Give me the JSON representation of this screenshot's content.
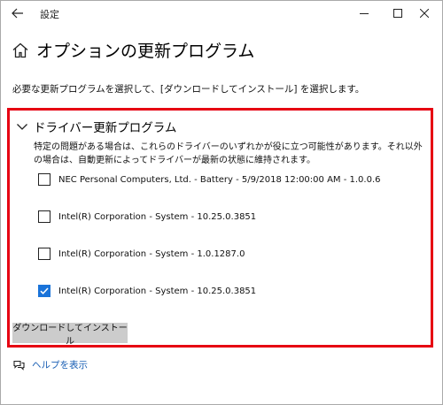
{
  "window": {
    "app_title": "設定"
  },
  "header": {
    "title": "オプションの更新プログラム"
  },
  "instruction": "必要な更新プログラムを選択して、[ダウンロードしてインストール] を選択します。",
  "section": {
    "title": "ドライバー更新プログラム",
    "description": "特定の問題がある場合は、これらのドライバーのいずれかが役に立つ可能性があります。それ以外の場合は、自動更新によってドライバーが最新の状態に維持されます。",
    "items": [
      {
        "label": "NEC Personal Computers, Ltd. - Battery - 5/9/2018 12:00:00 AM - 1.0.0.6",
        "checked": false
      },
      {
        "label": "Intel(R) Corporation - System - 10.25.0.3851",
        "checked": false
      },
      {
        "label": "Intel(R) Corporation - System - 1.0.1287.0",
        "checked": false
      },
      {
        "label": "Intel(R) Corporation - System - 10.25.0.3851",
        "checked": true
      }
    ]
  },
  "install_button": "ダウンロードしてインストール",
  "help_link": "ヘルプを表示",
  "colors": {
    "highlight": "#e60012",
    "checked": "#1a73d9",
    "link": "#1a5fb4",
    "button": "#cccccc"
  },
  "icons": {
    "back": "back-arrow-icon",
    "home": "home-icon",
    "chevron": "chevron-down-icon",
    "help": "help-chat-icon"
  }
}
